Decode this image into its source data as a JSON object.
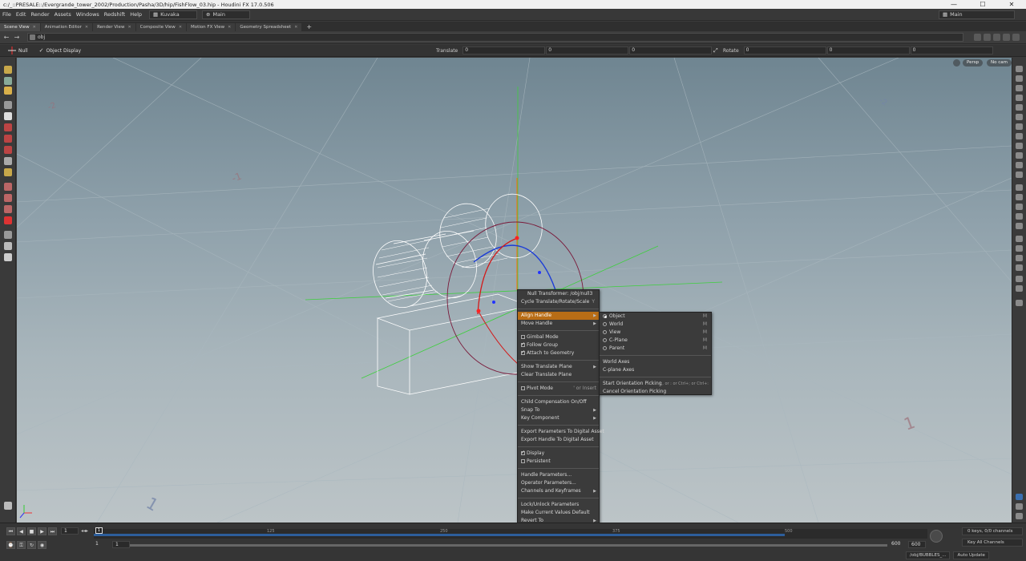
{
  "window": {
    "title": "c:/_::PRESALE::/Evergrande_tower_2002/Production/Pasha/3D/hip/FishFlow_03.hip - Houdini FX 17.0.506",
    "minimize": "—",
    "maximize": "☐",
    "close": "✕"
  },
  "menubar": {
    "items": [
      "File",
      "Edit",
      "Render",
      "Assets",
      "Windows",
      "Redshift",
      "Help"
    ],
    "shelf_dropdown": "Kuvaka",
    "desktop_dropdown": "Main",
    "right_dropdown": "Main"
  },
  "pane_tabs": [
    "Scene View",
    "Animation Editor",
    "Render View",
    "Composite View",
    "Motion FX View",
    "Geometry Spreadsheet"
  ],
  "path": {
    "value": "obj"
  },
  "op_toolbar": {
    "node_label": "Null",
    "object_display": "Object Display",
    "translate_label": "Translate",
    "translate": [
      "0",
      "0",
      "0"
    ],
    "rotate_label": "Rotate",
    "rotate": [
      "0",
      "0",
      "0"
    ]
  },
  "viewport": {
    "persp": "Persp",
    "cam": "No cam"
  },
  "context_menu": {
    "header": "Null Transformer: /obj/null3",
    "cycle": "Cycle Translate/Rotate/Scale",
    "cycle_hotkey": "Y",
    "align_handle": "Align Handle",
    "move_handle": "Move Handle",
    "gimbal_mode": "Gimbal Mode",
    "follow_group": "Follow Group",
    "attach_geometry": "Attach to Geometry",
    "show_translate_plane": "Show Translate Plane",
    "clear_translate_plane": "Clear Translate Plane",
    "pivot_mode": "Pivot Mode",
    "pivot_hotkey": "' or Insert",
    "child_compensation": "Child Compensation On/Off",
    "snap_to": "Snap To",
    "key_component": "Key Component",
    "export_params": "Export Parameters To Digital Asset",
    "export_handle": "Export Handle To Digital Asset",
    "display": "Display",
    "persistent": "Persistent",
    "handle_params": "Handle Parameters...",
    "operator_params": "Operator Parameters...",
    "channels_keyframes": "Channels and Keyframes",
    "lock_unlock": "Lock/Unlock Parameters",
    "make_default": "Make Current Values Default",
    "revert_to": "Revert To"
  },
  "submenu": {
    "object": "Object",
    "world": "World",
    "view": "View",
    "cplane": "C-Plane",
    "parent": "Parent",
    "hotkey_m": "M",
    "world_axes": "World Axes",
    "cplane_axes": "C-plane Axes",
    "start_orientation": "Start Orientation Picking",
    "start_orientation_hotkey": ";, or : or Ctrl+; or Ctrl+:",
    "cancel_orientation": "Cancel Orientation Picking"
  },
  "timeline": {
    "current_frame": "1",
    "ticks": [
      "125",
      "250",
      "375",
      "500"
    ],
    "start_frame": "1",
    "start_frame2": "1",
    "end_frame": "600",
    "end_frame2": "600",
    "keys_info": "0 keys, 0/0 channels",
    "key_all": "Key All Channels",
    "path_status": "/obj/BUBBLES_...",
    "auto_update": "Auto Update"
  },
  "colors": {
    "highlight": "#b86d16",
    "timeline_range": "#2d5e9b"
  }
}
